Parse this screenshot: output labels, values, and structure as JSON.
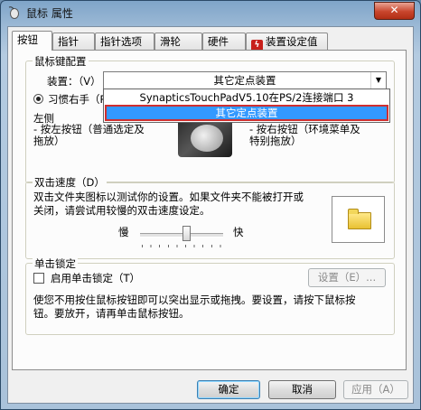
{
  "window": {
    "title": "鼠标 属性",
    "close_glyph": "✕"
  },
  "tabs": [
    {
      "label": "按钮",
      "active": true
    },
    {
      "label": "指针"
    },
    {
      "label": "指针选项"
    },
    {
      "label": "滑轮"
    },
    {
      "label": "硬件"
    },
    {
      "label": "装置设定值"
    }
  ],
  "button_config": {
    "group_label": "鼠标键配置",
    "device_label": "装置：（V）",
    "device_value": "其它定点装置",
    "dropdown_options": [
      "SynapticsTouchPadV5.10在PS/2连接端口 3",
      "其它定点装置"
    ],
    "right_hand_label": "习惯右手（R",
    "left_label": "左侧",
    "left_desc": "- 按左按钮（普通选定及\n拖放）",
    "right_desc": "- 按右按钮（环境菜单及\n特别拖放）"
  },
  "double_click": {
    "group_label": "双击速度（D）",
    "description": "双击文件夹图标以测试你的设置。如果文件夹不能被打开或\n关闭，请尝试用较慢的双击速度设定。",
    "slow_label": "慢",
    "fast_label": "快",
    "speed_level": 0.55
  },
  "click_lock": {
    "group_label": "单击锁定",
    "enable_label": "启用单击锁定（T）",
    "settings_label": "设置（E）...",
    "description": "使您不用按住鼠标按钮即可以突出显示或拖拽。要设置，请按下鼠标按\n钮。要放开，请再单击鼠标按钮。"
  },
  "buttons": {
    "ok": "确定",
    "cancel": "取消",
    "apply": "应用（A）"
  },
  "icons": {
    "app": "mouse-properties-icon",
    "tab_device": "synaptics-icon",
    "folder": "folder-icon"
  }
}
